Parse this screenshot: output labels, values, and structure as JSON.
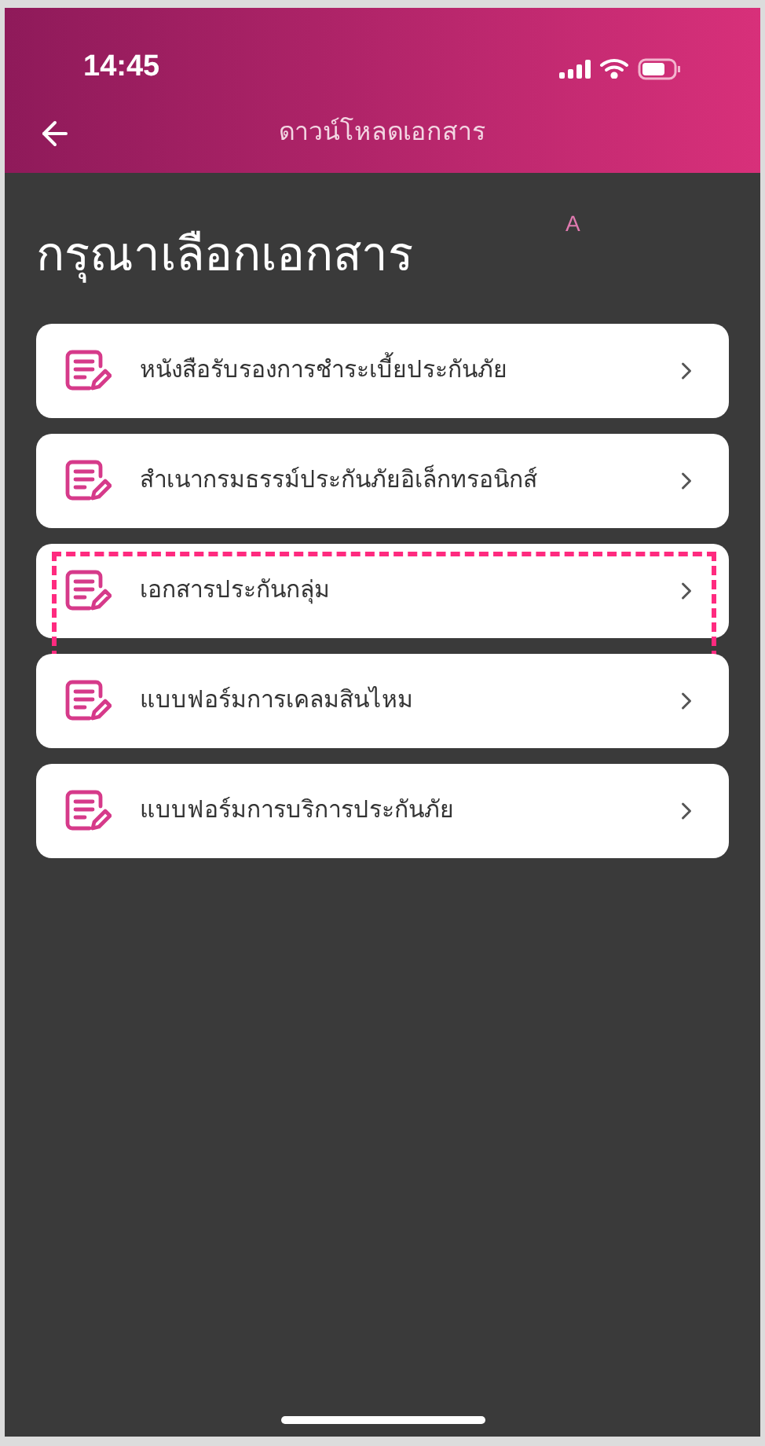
{
  "status_bar": {
    "time": "14:45"
  },
  "nav": {
    "title": "ดาวน์โหลดเอกสาร"
  },
  "heading": "กรุณาเลือกเอกสาร",
  "marker": "A",
  "items": [
    {
      "label": "หนังสือรับรองการชำระเบี้ยประกันภัย",
      "highlighted": false
    },
    {
      "label": "สำเนากรมธรรม์ประกันภัยอิเล็กทรอนิกส์",
      "highlighted": false
    },
    {
      "label": "เอกสารประกันกลุ่ม",
      "highlighted": true
    },
    {
      "label": "แบบฟอร์มการเคลมสินไหม",
      "highlighted": false
    },
    {
      "label": "แบบฟอร์มการบริการประกันภัย",
      "highlighted": false
    }
  ]
}
